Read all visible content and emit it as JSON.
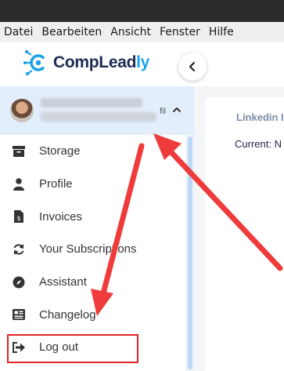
{
  "menubar": {
    "items": [
      "Datei",
      "Bearbeiten",
      "Ansicht",
      "Fenster",
      "Hilfe"
    ]
  },
  "brand": {
    "part1": "CompLead",
    "part2": "ly",
    "colors": {
      "dark": "#1f2a52",
      "accent": "#1aa3e8"
    }
  },
  "user": {
    "name_suffix": "fil"
  },
  "sidebar": {
    "items": [
      {
        "label": "Storage",
        "icon": "archive-icon"
      },
      {
        "label": "Profile",
        "icon": "user-icon"
      },
      {
        "label": "Invoices",
        "icon": "invoice-icon"
      },
      {
        "label": "Your Subscriptions",
        "icon": "refresh-icon"
      },
      {
        "label": "Assistant",
        "icon": "compass-icon"
      },
      {
        "label": "Changelog",
        "icon": "newspaper-icon"
      },
      {
        "label": "Log out",
        "icon": "logout-icon"
      }
    ]
  },
  "main": {
    "card_title": "Linkedin I",
    "card_text": "Current: N"
  },
  "annotation": {
    "arrow_color": "#ef3b3b",
    "highlight_color": "#e0242a"
  }
}
